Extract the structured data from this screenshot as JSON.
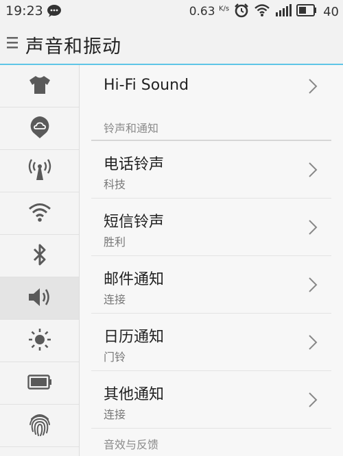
{
  "status_bar": {
    "time": "19:23",
    "net_speed": "0.63",
    "net_speed_unit": "K/s",
    "battery": "40"
  },
  "header": {
    "title": "声音和振动"
  },
  "sidebar": {
    "items": [
      {
        "icon": "tshirt-icon",
        "active": false
      },
      {
        "icon": "cloud-pin-icon",
        "active": false
      },
      {
        "icon": "hotspot-icon",
        "active": false
      },
      {
        "icon": "wifi-icon",
        "active": false
      },
      {
        "icon": "bluetooth-icon",
        "active": false
      },
      {
        "icon": "speaker-icon",
        "active": true
      },
      {
        "icon": "brightness-icon",
        "active": false
      },
      {
        "icon": "battery-icon",
        "active": false
      },
      {
        "icon": "fingerprint-icon",
        "active": false
      }
    ]
  },
  "main": {
    "hifi": "Hi-Fi Sound",
    "section_ringtones": "铃声和通知",
    "rows": [
      {
        "title": "电话铃声",
        "value": "科技"
      },
      {
        "title": "短信铃声",
        "value": "胜利"
      },
      {
        "title": "邮件通知",
        "value": "连接"
      },
      {
        "title": "日历通知",
        "value": "门铃"
      },
      {
        "title": "其他通知",
        "value": "连接"
      }
    ],
    "section_effects": "音效与反馈"
  },
  "colors": {
    "accent": "#5ec5e6",
    "icon": "#5a5a5a"
  }
}
